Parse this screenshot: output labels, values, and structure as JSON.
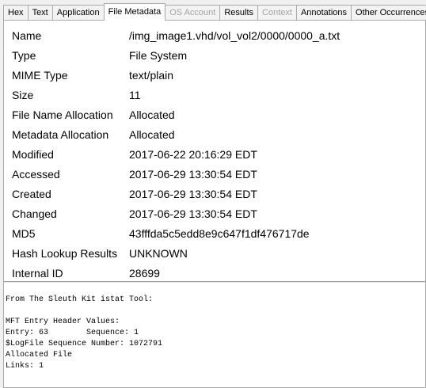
{
  "tabs": [
    {
      "label": "Hex",
      "state": "normal"
    },
    {
      "label": "Text",
      "state": "normal"
    },
    {
      "label": "Application",
      "state": "normal"
    },
    {
      "label": "File Metadata",
      "state": "active"
    },
    {
      "label": "OS Account",
      "state": "disabled"
    },
    {
      "label": "Results",
      "state": "normal"
    },
    {
      "label": "Context",
      "state": "disabled"
    },
    {
      "label": "Annotations",
      "state": "normal"
    },
    {
      "label": "Other Occurrences",
      "state": "normal"
    }
  ],
  "metadata": {
    "rows": [
      {
        "key": "Name",
        "value": "/img_image1.vhd/vol_vol2/0000/0000_a.txt"
      },
      {
        "key": "Type",
        "value": "File System"
      },
      {
        "key": "MIME Type",
        "value": "text/plain"
      },
      {
        "key": "Size",
        "value": "11"
      },
      {
        "key": "File Name Allocation",
        "value": "Allocated"
      },
      {
        "key": "Metadata Allocation",
        "value": "Allocated"
      },
      {
        "key": "Modified",
        "value": "2017-06-22 20:16:29 EDT"
      },
      {
        "key": "Accessed",
        "value": "2017-06-29 13:30:54 EDT"
      },
      {
        "key": "Created",
        "value": "2017-06-29 13:30:54 EDT"
      },
      {
        "key": "Changed",
        "value": "2017-06-29 13:30:54 EDT"
      },
      {
        "key": "MD5",
        "value": "43fffda5c5edd8e9c647f1df476717de"
      },
      {
        "key": "Hash Lookup Results",
        "value": "UNKNOWN"
      },
      {
        "key": "Internal ID",
        "value": "28699"
      }
    ]
  },
  "istat": {
    "lines": [
      "From The Sleuth Kit istat Tool:",
      "",
      "MFT Entry Header Values:",
      "Entry: 63        Sequence: 1",
      "$LogFile Sequence Number: 1072791",
      "Allocated File",
      "Links: 1"
    ]
  }
}
